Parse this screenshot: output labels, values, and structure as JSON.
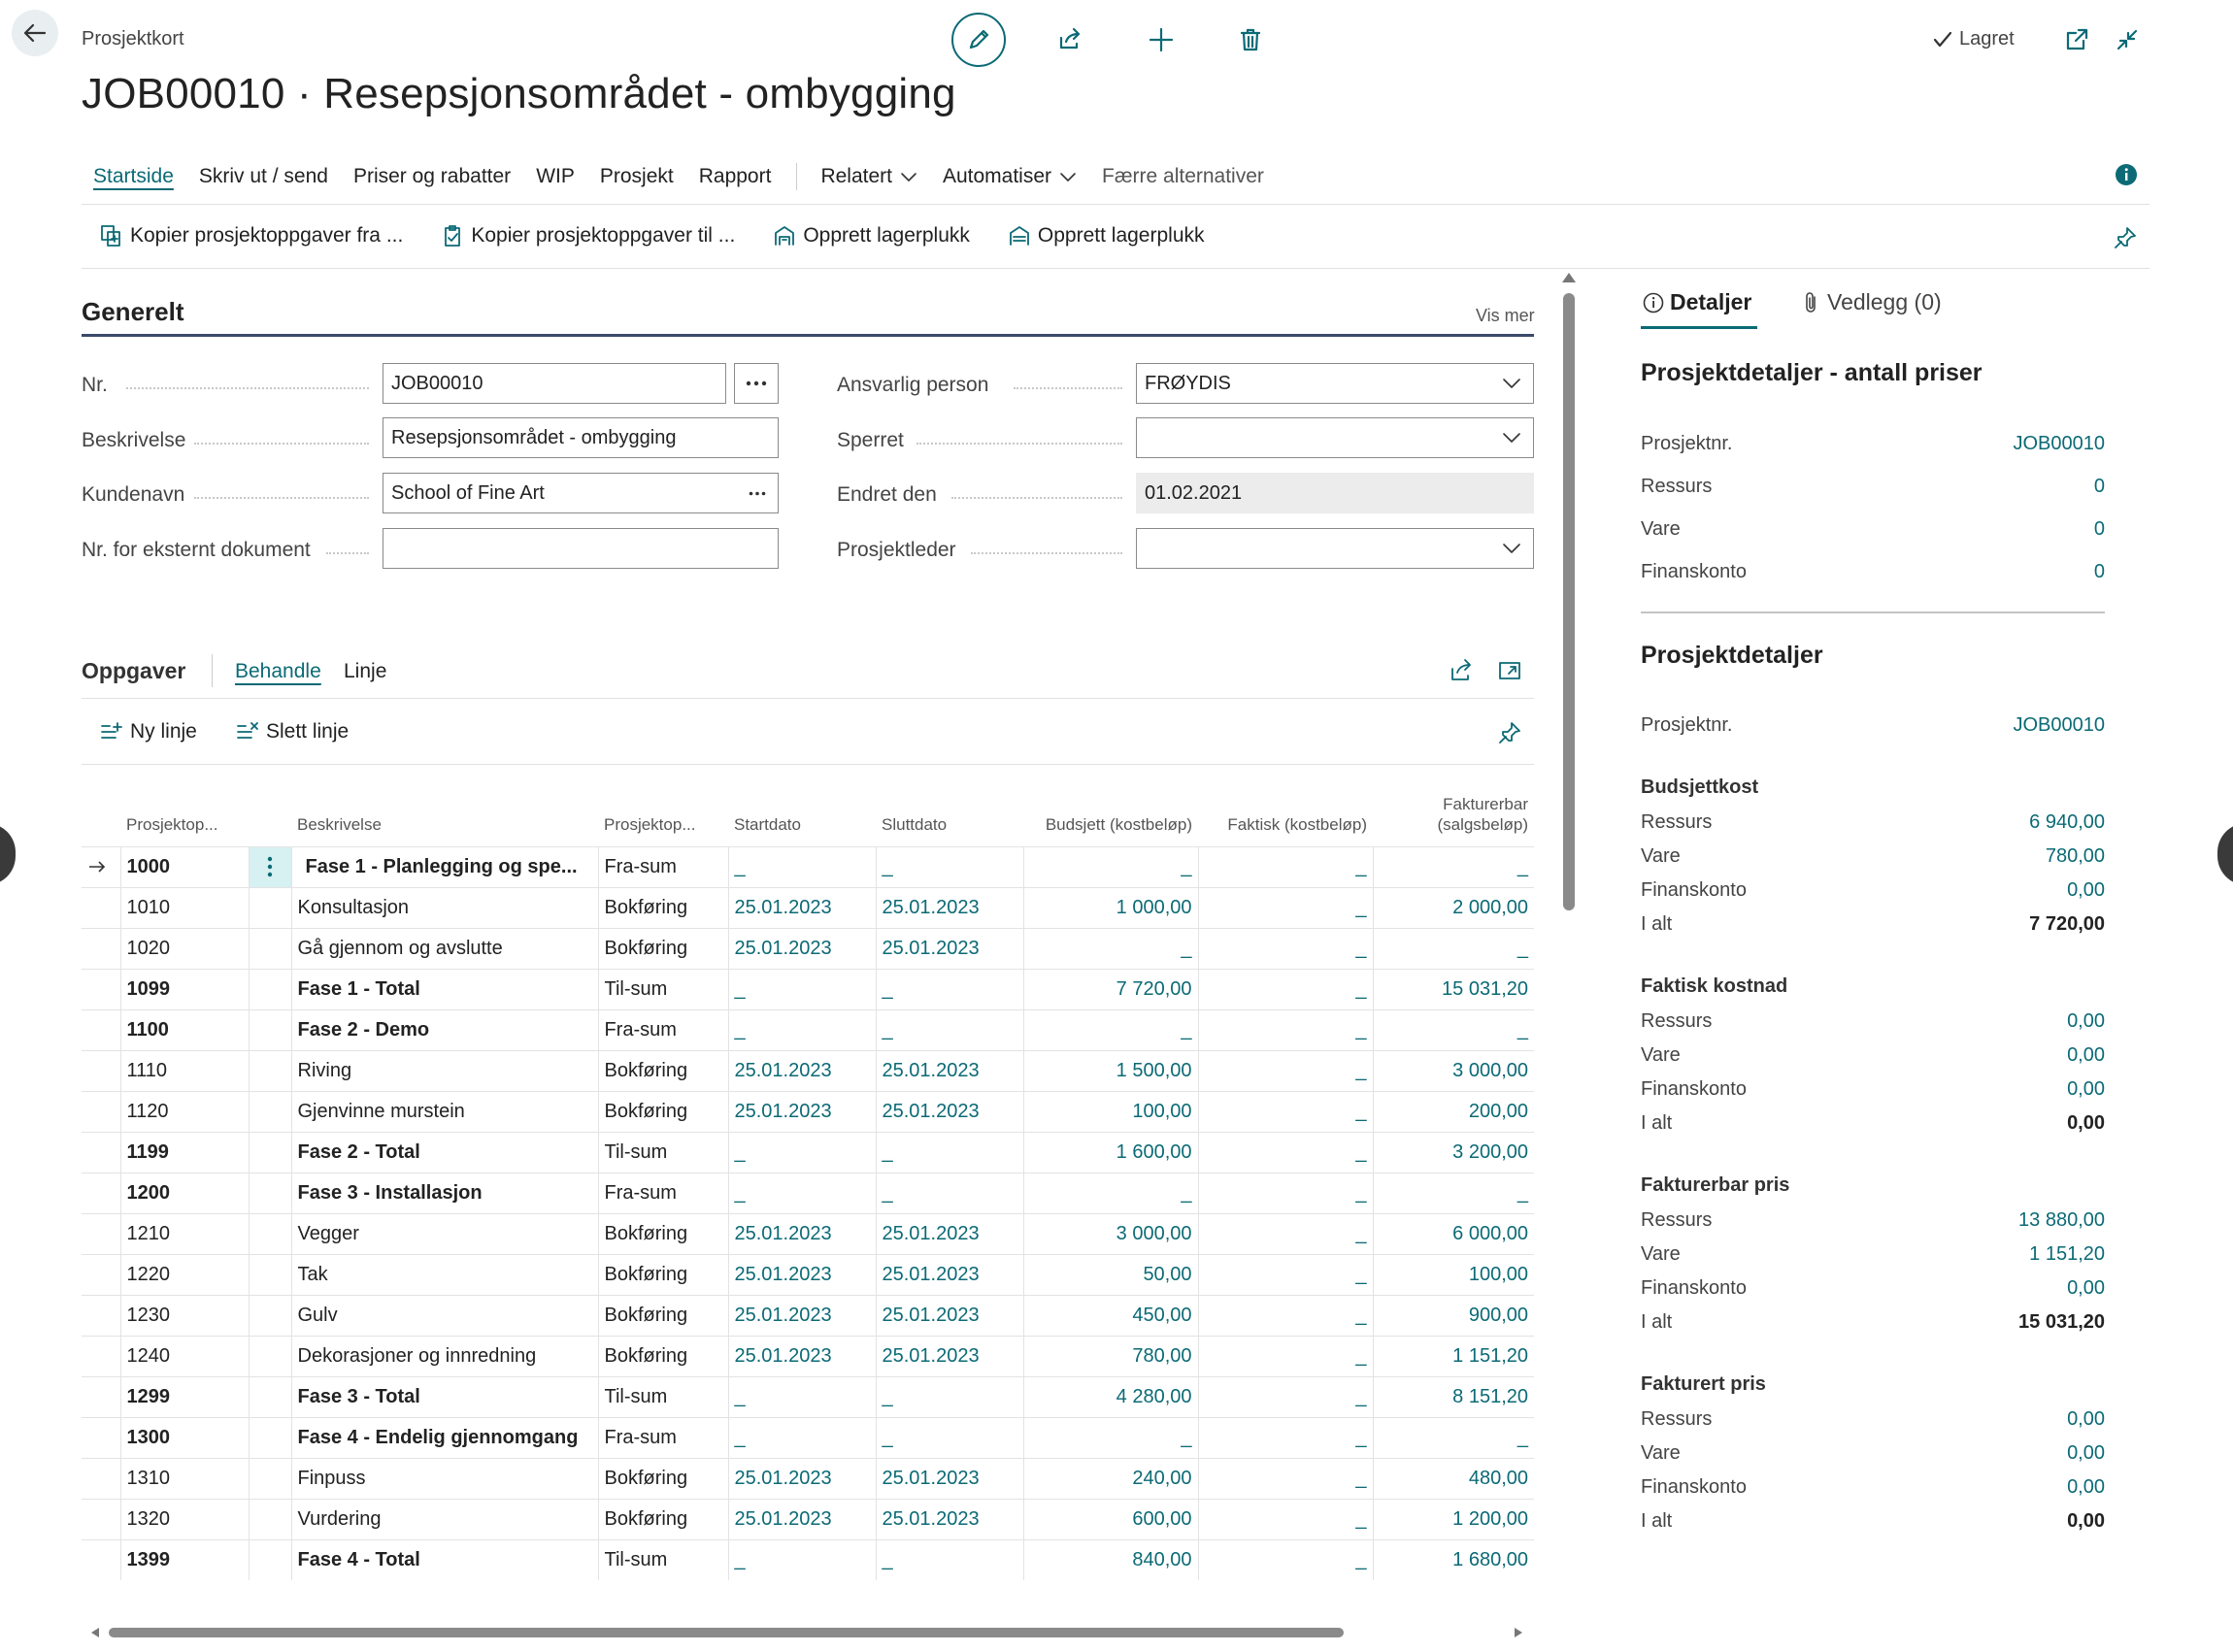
{
  "header": {
    "breadcrumb": "Prosjektkort",
    "title": "JOB00010 · Resepsjonsområdet - ombygging",
    "saved_label": "Lagret"
  },
  "menu": {
    "items": [
      "Startside",
      "Skriv ut / send",
      "Priser og rabatter",
      "WIP",
      "Prosjekt",
      "Rapport"
    ],
    "related": "Relatert",
    "automate": "Automatiser",
    "fewer": "Færre alternativer"
  },
  "actions": [
    "Kopier prosjektoppgaver fra ...",
    "Kopier prosjektoppgaver til ...",
    "Opprett lagerplukk",
    "Opprett lagerplukk"
  ],
  "general": {
    "title": "Generelt",
    "show_more": "Vis mer",
    "fields": {
      "nr_label": "Nr.",
      "nr_value": "JOB00010",
      "desc_label": "Beskrivelse",
      "desc_value": "Resepsjonsområdet - ombygging",
      "customer_label": "Kundenavn",
      "customer_value": "School of Fine Art",
      "extdoc_label": "Nr. for eksternt dokument",
      "extdoc_value": "",
      "resp_label": "Ansvarlig person",
      "resp_value": "FRØYDIS",
      "blocked_label": "Sperret",
      "blocked_value": "",
      "changed_label": "Endret den",
      "changed_value": "01.02.2021",
      "manager_label": "Prosjektleder",
      "manager_value": ""
    }
  },
  "tasks": {
    "title": "Oppgaver",
    "tab_manage": "Behandle",
    "tab_line": "Linje",
    "new_line": "Ny linje",
    "delete_line": "Slett linje",
    "columns": [
      "Prosjektop...",
      "Beskrivelse",
      "Prosjektop...",
      "Startdato",
      "Sluttdato",
      "Budsjett (kostbeløp)",
      "Faktisk (kostbeløp)",
      "Fakturerbar (salgsbeløp)"
    ],
    "rows": [
      {
        "no": "1000",
        "desc": "Fase 1 - Planlegging og spe...",
        "type": "Fra-sum",
        "start": "_",
        "end": "_",
        "budget": "_",
        "actual": "_",
        "billable": "_",
        "bold": true,
        "selected": true
      },
      {
        "no": "1010",
        "desc": "Konsultasjon",
        "type": "Bokføring",
        "start": "25.01.2023",
        "end": "25.01.2023",
        "budget": "1 000,00",
        "actual": "_",
        "billable": "2 000,00",
        "bold": false
      },
      {
        "no": "1020",
        "desc": "Gå gjennom og avslutte",
        "type": "Bokføring",
        "start": "25.01.2023",
        "end": "25.01.2023",
        "budget": "_",
        "actual": "_",
        "billable": "_",
        "bold": false
      },
      {
        "no": "1099",
        "desc": "Fase 1 - Total",
        "type": "Til-sum",
        "start": "_",
        "end": "_",
        "budget": "7 720,00",
        "actual": "_",
        "billable": "15 031,20",
        "bold": true
      },
      {
        "no": "1100",
        "desc": "Fase 2 - Demo",
        "type": "Fra-sum",
        "start": "_",
        "end": "_",
        "budget": "_",
        "actual": "_",
        "billable": "_",
        "bold": true
      },
      {
        "no": "1110",
        "desc": "Riving",
        "type": "Bokføring",
        "start": "25.01.2023",
        "end": "25.01.2023",
        "budget": "1 500,00",
        "actual": "_",
        "billable": "3 000,00",
        "bold": false
      },
      {
        "no": "1120",
        "desc": "Gjenvinne murstein",
        "type": "Bokføring",
        "start": "25.01.2023",
        "end": "25.01.2023",
        "budget": "100,00",
        "actual": "_",
        "billable": "200,00",
        "bold": false
      },
      {
        "no": "1199",
        "desc": "Fase 2 - Total",
        "type": "Til-sum",
        "start": "_",
        "end": "_",
        "budget": "1 600,00",
        "actual": "_",
        "billable": "3 200,00",
        "bold": true
      },
      {
        "no": "1200",
        "desc": "Fase 3 - Installasjon",
        "type": "Fra-sum",
        "start": "_",
        "end": "_",
        "budget": "_",
        "actual": "_",
        "billable": "_",
        "bold": true
      },
      {
        "no": "1210",
        "desc": "Vegger",
        "type": "Bokføring",
        "start": "25.01.2023",
        "end": "25.01.2023",
        "budget": "3 000,00",
        "actual": "_",
        "billable": "6 000,00",
        "bold": false
      },
      {
        "no": "1220",
        "desc": "Tak",
        "type": "Bokføring",
        "start": "25.01.2023",
        "end": "25.01.2023",
        "budget": "50,00",
        "actual": "_",
        "billable": "100,00",
        "bold": false
      },
      {
        "no": "1230",
        "desc": "Gulv",
        "type": "Bokføring",
        "start": "25.01.2023",
        "end": "25.01.2023",
        "budget": "450,00",
        "actual": "_",
        "billable": "900,00",
        "bold": false
      },
      {
        "no": "1240",
        "desc": "Dekorasjoner og innredning",
        "type": "Bokføring",
        "start": "25.01.2023",
        "end": "25.01.2023",
        "budget": "780,00",
        "actual": "_",
        "billable": "1 151,20",
        "bold": false
      },
      {
        "no": "1299",
        "desc": "Fase 3 - Total",
        "type": "Til-sum",
        "start": "_",
        "end": "_",
        "budget": "4 280,00",
        "actual": "_",
        "billable": "8 151,20",
        "bold": true
      },
      {
        "no": "1300",
        "desc": "Fase 4 - Endelig gjennomgang",
        "type": "Fra-sum",
        "start": "_",
        "end": "_",
        "budget": "_",
        "actual": "_",
        "billable": "_",
        "bold": true
      },
      {
        "no": "1310",
        "desc": "Finpuss",
        "type": "Bokføring",
        "start": "25.01.2023",
        "end": "25.01.2023",
        "budget": "240,00",
        "actual": "_",
        "billable": "480,00",
        "bold": false
      },
      {
        "no": "1320",
        "desc": "Vurdering",
        "type": "Bokføring",
        "start": "25.01.2023",
        "end": "25.01.2023",
        "budget": "600,00",
        "actual": "_",
        "billable": "1 200,00",
        "bold": false
      },
      {
        "no": "1399",
        "desc": "Fase 4 - Total",
        "type": "Til-sum",
        "start": "_",
        "end": "_",
        "budget": "840,00",
        "actual": "_",
        "billable": "1 680,00",
        "bold": true
      }
    ]
  },
  "factbox": {
    "tab_details": "Detaljer",
    "tab_attachments": "Vedlegg (0)",
    "price_count": {
      "title": "Prosjektdetaljer - antall priser",
      "rows": [
        {
          "label": "Prosjektnr.",
          "value": "JOB00010"
        },
        {
          "label": "Ressurs",
          "value": "0"
        },
        {
          "label": "Vare",
          "value": "0"
        },
        {
          "label": "Finanskonto",
          "value": "0"
        }
      ]
    },
    "details": {
      "title": "Prosjektdetaljer",
      "project_no_label": "Prosjektnr.",
      "project_no": "JOB00010",
      "groups": [
        {
          "title": "Budsjettkost",
          "rows": [
            {
              "label": "Ressurs",
              "value": "6 940,00"
            },
            {
              "label": "Vare",
              "value": "780,00"
            },
            {
              "label": "Finanskonto",
              "value": "0,00"
            },
            {
              "label": "I alt",
              "value": "7 720,00",
              "total": true
            }
          ]
        },
        {
          "title": "Faktisk kostnad",
          "rows": [
            {
              "label": "Ressurs",
              "value": "0,00"
            },
            {
              "label": "Vare",
              "value": "0,00"
            },
            {
              "label": "Finanskonto",
              "value": "0,00"
            },
            {
              "label": "I alt",
              "value": "0,00",
              "total": true
            }
          ]
        },
        {
          "title": "Fakturerbar pris",
          "rows": [
            {
              "label": "Ressurs",
              "value": "13 880,00"
            },
            {
              "label": "Vare",
              "value": "1 151,20"
            },
            {
              "label": "Finanskonto",
              "value": "0,00"
            },
            {
              "label": "I alt",
              "value": "15 031,20",
              "total": true
            }
          ]
        },
        {
          "title": "Fakturert pris",
          "rows": [
            {
              "label": "Ressurs",
              "value": "0,00"
            },
            {
              "label": "Vare",
              "value": "0,00"
            },
            {
              "label": "Finanskonto",
              "value": "0,00"
            },
            {
              "label": "I alt",
              "value": "0,00",
              "total": true
            }
          ]
        }
      ]
    }
  },
  "colors": {
    "accent": "#0b6a75",
    "info": "#0b6a75",
    "selection": "#d7f0f2"
  }
}
